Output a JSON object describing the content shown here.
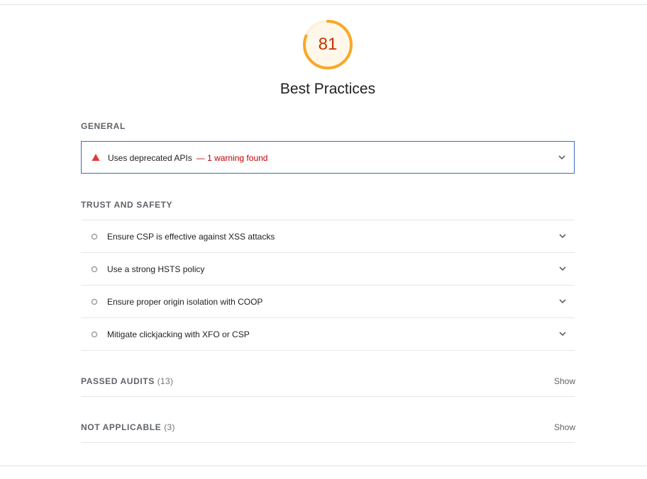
{
  "gauge": {
    "score": "81",
    "fraction": 0.81,
    "color": "#f9a825"
  },
  "category_title": "Best Practices",
  "general": {
    "title": "GENERAL",
    "audits": [
      {
        "label": "Uses deprecated APIs",
        "warning": "— 1 warning found",
        "status_icon": "triangle-fail-icon"
      }
    ]
  },
  "trust": {
    "title": "TRUST AND SAFETY",
    "audits": [
      {
        "label": "Ensure CSP is effective against XSS attacks",
        "status_icon": "circle-informative-icon"
      },
      {
        "label": "Use a strong HSTS policy",
        "status_icon": "circle-informative-icon"
      },
      {
        "label": "Ensure proper origin isolation with COOP",
        "status_icon": "circle-informative-icon"
      },
      {
        "label": "Mitigate clickjacking with XFO or CSP",
        "status_icon": "circle-informative-icon"
      }
    ]
  },
  "passed": {
    "title": "PASSED AUDITS",
    "count": "(13)",
    "show_label": "Show"
  },
  "not_applicable": {
    "title": "NOT APPLICABLE",
    "count": "(3)",
    "show_label": "Show"
  },
  "colors": {
    "fail": "#e53935",
    "warning_text": "#c00000",
    "open_border": "#3b6bcc"
  }
}
